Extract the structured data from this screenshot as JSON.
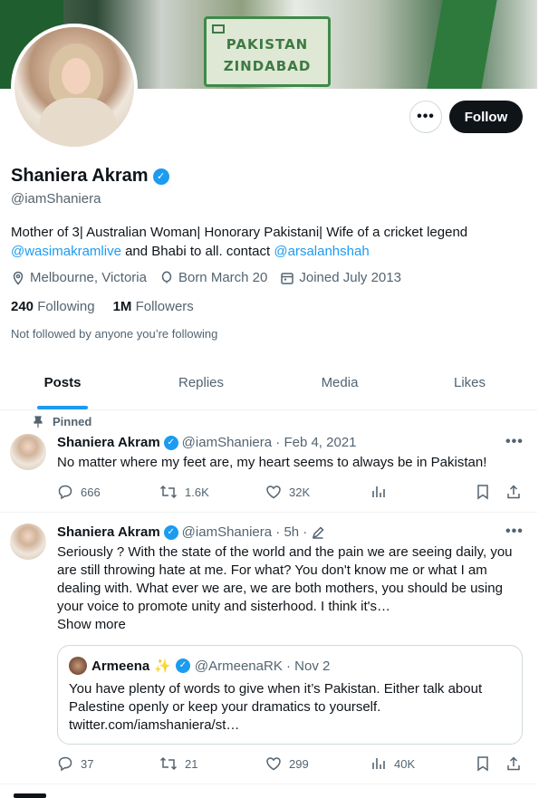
{
  "banner": {
    "sign_text_1": "PAKISTAN",
    "sign_text_2": "ZINDABAD"
  },
  "profile": {
    "name": "Shaniera Akram",
    "handle": "@iamShaniera",
    "bio_text_1": "Mother of 3| Australian Woman| Honorary Pakistani| Wife of a cricket legend",
    "bio_link_1": "@wasimakramlive",
    "bio_text_2": " and Bhabi to all. contact ",
    "bio_link_2": "@arsalanhshah",
    "location": "Melbourne, Victoria",
    "born": "Born March 20",
    "joined": "Joined July 2013",
    "following_count": "240",
    "following_label": "Following",
    "followers_count": "1M",
    "followers_label": "Followers",
    "not_followed": "Not followed by anyone you’re following"
  },
  "buttons": {
    "more": "•••",
    "follow": "Follow"
  },
  "tabs": [
    {
      "label": "Posts",
      "active": true
    },
    {
      "label": "Replies"
    },
    {
      "label": "Media"
    },
    {
      "label": "Likes"
    }
  ],
  "tweets": [
    {
      "pinned_label": "Pinned",
      "name": "Shaniera Akram",
      "handle_date": "@iamShaniera · Feb 4, 2021",
      "text": "No matter where my feet are, my heart seems to always be in Pakistan!",
      "replies": "666",
      "retweets": "1.6K",
      "likes": "32K",
      "views": ""
    },
    {
      "name": "Shaniera Akram",
      "handle_date": "@iamShaniera · 5h ·",
      "text": "Seriously ? With the state of the world and the pain we are seeing daily, you are still throwing hate at me. For what? You don't know me or what I am dealing with. What ever we are, we are both mothers, you should be using your voice to promote unity and sisterhood. I think it's…",
      "show_more": "Show more",
      "replies": "37",
      "retweets": "21",
      "likes": "299",
      "views": "40K",
      "quote": {
        "name": "Armeena",
        "handle_date": "@ArmeenaRK · Nov 2",
        "text": "You have plenty of words to give when it’s Pakistan. Either talk about Palestine openly or keep your dramatics to yourself. twitter.com/iamshaniera/st…"
      }
    }
  ],
  "colors": {
    "accent": "#1d9bf0",
    "text": "#0f1419",
    "muted": "#536471",
    "border": "#eff3f4"
  }
}
